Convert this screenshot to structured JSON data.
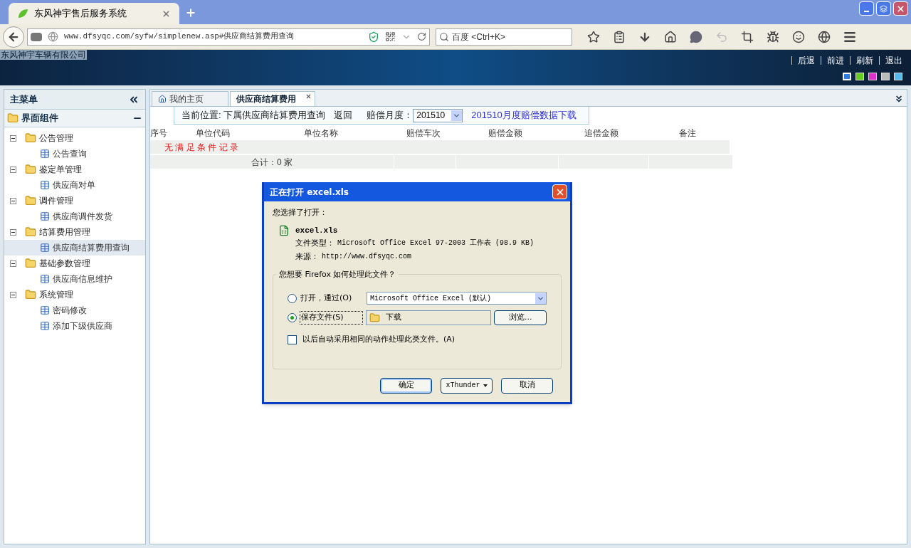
{
  "browser": {
    "tab_title": "东风神宇售后服务系统",
    "url": "www.dfsyqc.com/syfw/simplenew.asp#供应商结算费用查询",
    "search_placeholder": "百度 <Ctrl+K>"
  },
  "header": {
    "company": "东风神宇车辆有限公司",
    "nav_links": [
      "后退",
      "前进",
      "刷新",
      "退出"
    ],
    "themes": [
      {
        "color": "#2f7fe0",
        "selected": true
      },
      {
        "color": "#66cc22",
        "selected": false
      },
      {
        "color": "#dd33cc",
        "selected": false
      },
      {
        "color": "#bbbbbb",
        "selected": false
      },
      {
        "color": "#55bbee",
        "selected": false
      }
    ]
  },
  "sidebar": {
    "title": "主菜单",
    "section": "界面组件",
    "tree": [
      {
        "label": "公告管理",
        "expanded": true,
        "children": [
          {
            "label": "公告查询",
            "selected": false
          }
        ]
      },
      {
        "label": "鉴定单管理",
        "expanded": true,
        "children": [
          {
            "label": "供应商对单",
            "selected": false
          }
        ]
      },
      {
        "label": "调件管理",
        "expanded": true,
        "children": [
          {
            "label": "供应商调件发货",
            "selected": false
          }
        ]
      },
      {
        "label": "结算费用管理",
        "expanded": true,
        "children": [
          {
            "label": "供应商结算费用查询",
            "selected": true
          }
        ]
      },
      {
        "label": "基础参数管理",
        "expanded": true,
        "children": [
          {
            "label": "供应商信息维护",
            "selected": false
          }
        ]
      },
      {
        "label": "系统管理",
        "expanded": true,
        "children": [
          {
            "label": "密码修改",
            "selected": false
          },
          {
            "label": "添加下级供应商",
            "selected": false
          }
        ]
      }
    ]
  },
  "tabs": [
    {
      "label": "我的主页",
      "selected": false,
      "kind": "home"
    },
    {
      "label": "供应商结算费用",
      "selected": true,
      "kind": "closable"
    }
  ],
  "toolbar": {
    "location": "当前位置: 下属供应商结算费用查询",
    "back_link": "返回",
    "month_label": "赔偿月度：",
    "month_value": "201510",
    "download_link": "201510月度赔偿数据下载"
  },
  "table": {
    "columns": [
      "序号",
      "单位代码",
      "单位名称",
      "赔偿车次",
      "赔偿金额",
      "追偿金额",
      "备注"
    ],
    "empty_message": "无 满 足 条 件 记 录",
    "total": "合计：0 家"
  },
  "dialog": {
    "title": "正在打开 excel.xls",
    "intro": "您选择了打开：",
    "file_name": "excel.xls",
    "file_type_label": "文件类型：",
    "file_type": "Microsoft Office Excel 97-2003 工作表 (98.9 KB)",
    "source_label": "来源：",
    "source": "http://www.dfsyqc.com",
    "question": "您想要 Firefox 如何处理此文件？",
    "options": [
      {
        "kind": "open",
        "label": "打开，通过(O)",
        "selected": false,
        "value": "Microsoft Office Excel (默认)"
      },
      {
        "kind": "save",
        "label": "保存文件(S)",
        "selected": true,
        "value": "下载",
        "browse": "浏览..."
      }
    ],
    "remember": {
      "label": "以后自动采用相同的动作处理此类文件。(A)",
      "checked": false
    },
    "buttons": [
      {
        "kind": "default",
        "label": "确定"
      },
      {
        "kind": "menu",
        "label": "xThunder"
      },
      {
        "kind": "plain",
        "label": "取消"
      }
    ]
  }
}
